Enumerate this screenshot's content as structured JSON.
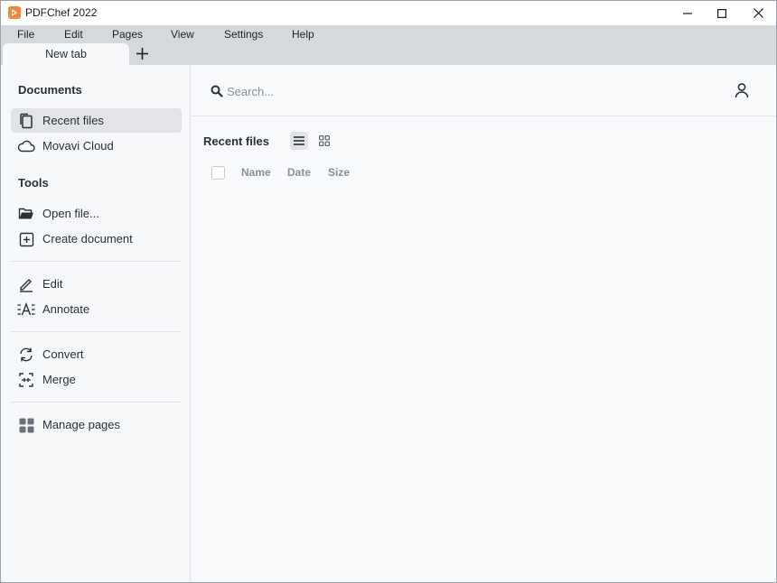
{
  "window": {
    "title": "PDFChef 2022",
    "accent": "#f0883e",
    "icons": {
      "minimize": "minimize-icon",
      "maximize": "maximize-icon",
      "close": "close-icon"
    }
  },
  "menu": {
    "items": [
      "File",
      "Edit",
      "Pages",
      "View",
      "Settings",
      "Help"
    ]
  },
  "tabs": {
    "items": [
      {
        "label": "New tab"
      }
    ],
    "add_icon": "plus-icon"
  },
  "sidebar": {
    "documents_title": "Documents",
    "documents": [
      {
        "label": "Recent files",
        "icon": "document-copy-icon",
        "active": true
      },
      {
        "label": "Movavi Cloud",
        "icon": "cloud-icon",
        "active": false
      }
    ],
    "tools_title": "Tools",
    "tools": [
      {
        "label": "Open file...",
        "icon": "folder-open-icon"
      },
      {
        "label": "Create document",
        "icon": "add-document-icon"
      },
      {
        "label": "Edit",
        "icon": "pen-icon"
      },
      {
        "label": "Annotate",
        "icon": "annotate-icon"
      },
      {
        "label": "Convert",
        "icon": "convert-icon"
      },
      {
        "label": "Merge",
        "icon": "merge-icon"
      },
      {
        "label": "Manage pages",
        "icon": "grid-pages-icon"
      }
    ]
  },
  "search": {
    "placeholder": "Search...",
    "value": ""
  },
  "main": {
    "recent_title": "Recent files",
    "columns": [
      "Name",
      "Date",
      "Size"
    ],
    "view_mode": "list"
  }
}
